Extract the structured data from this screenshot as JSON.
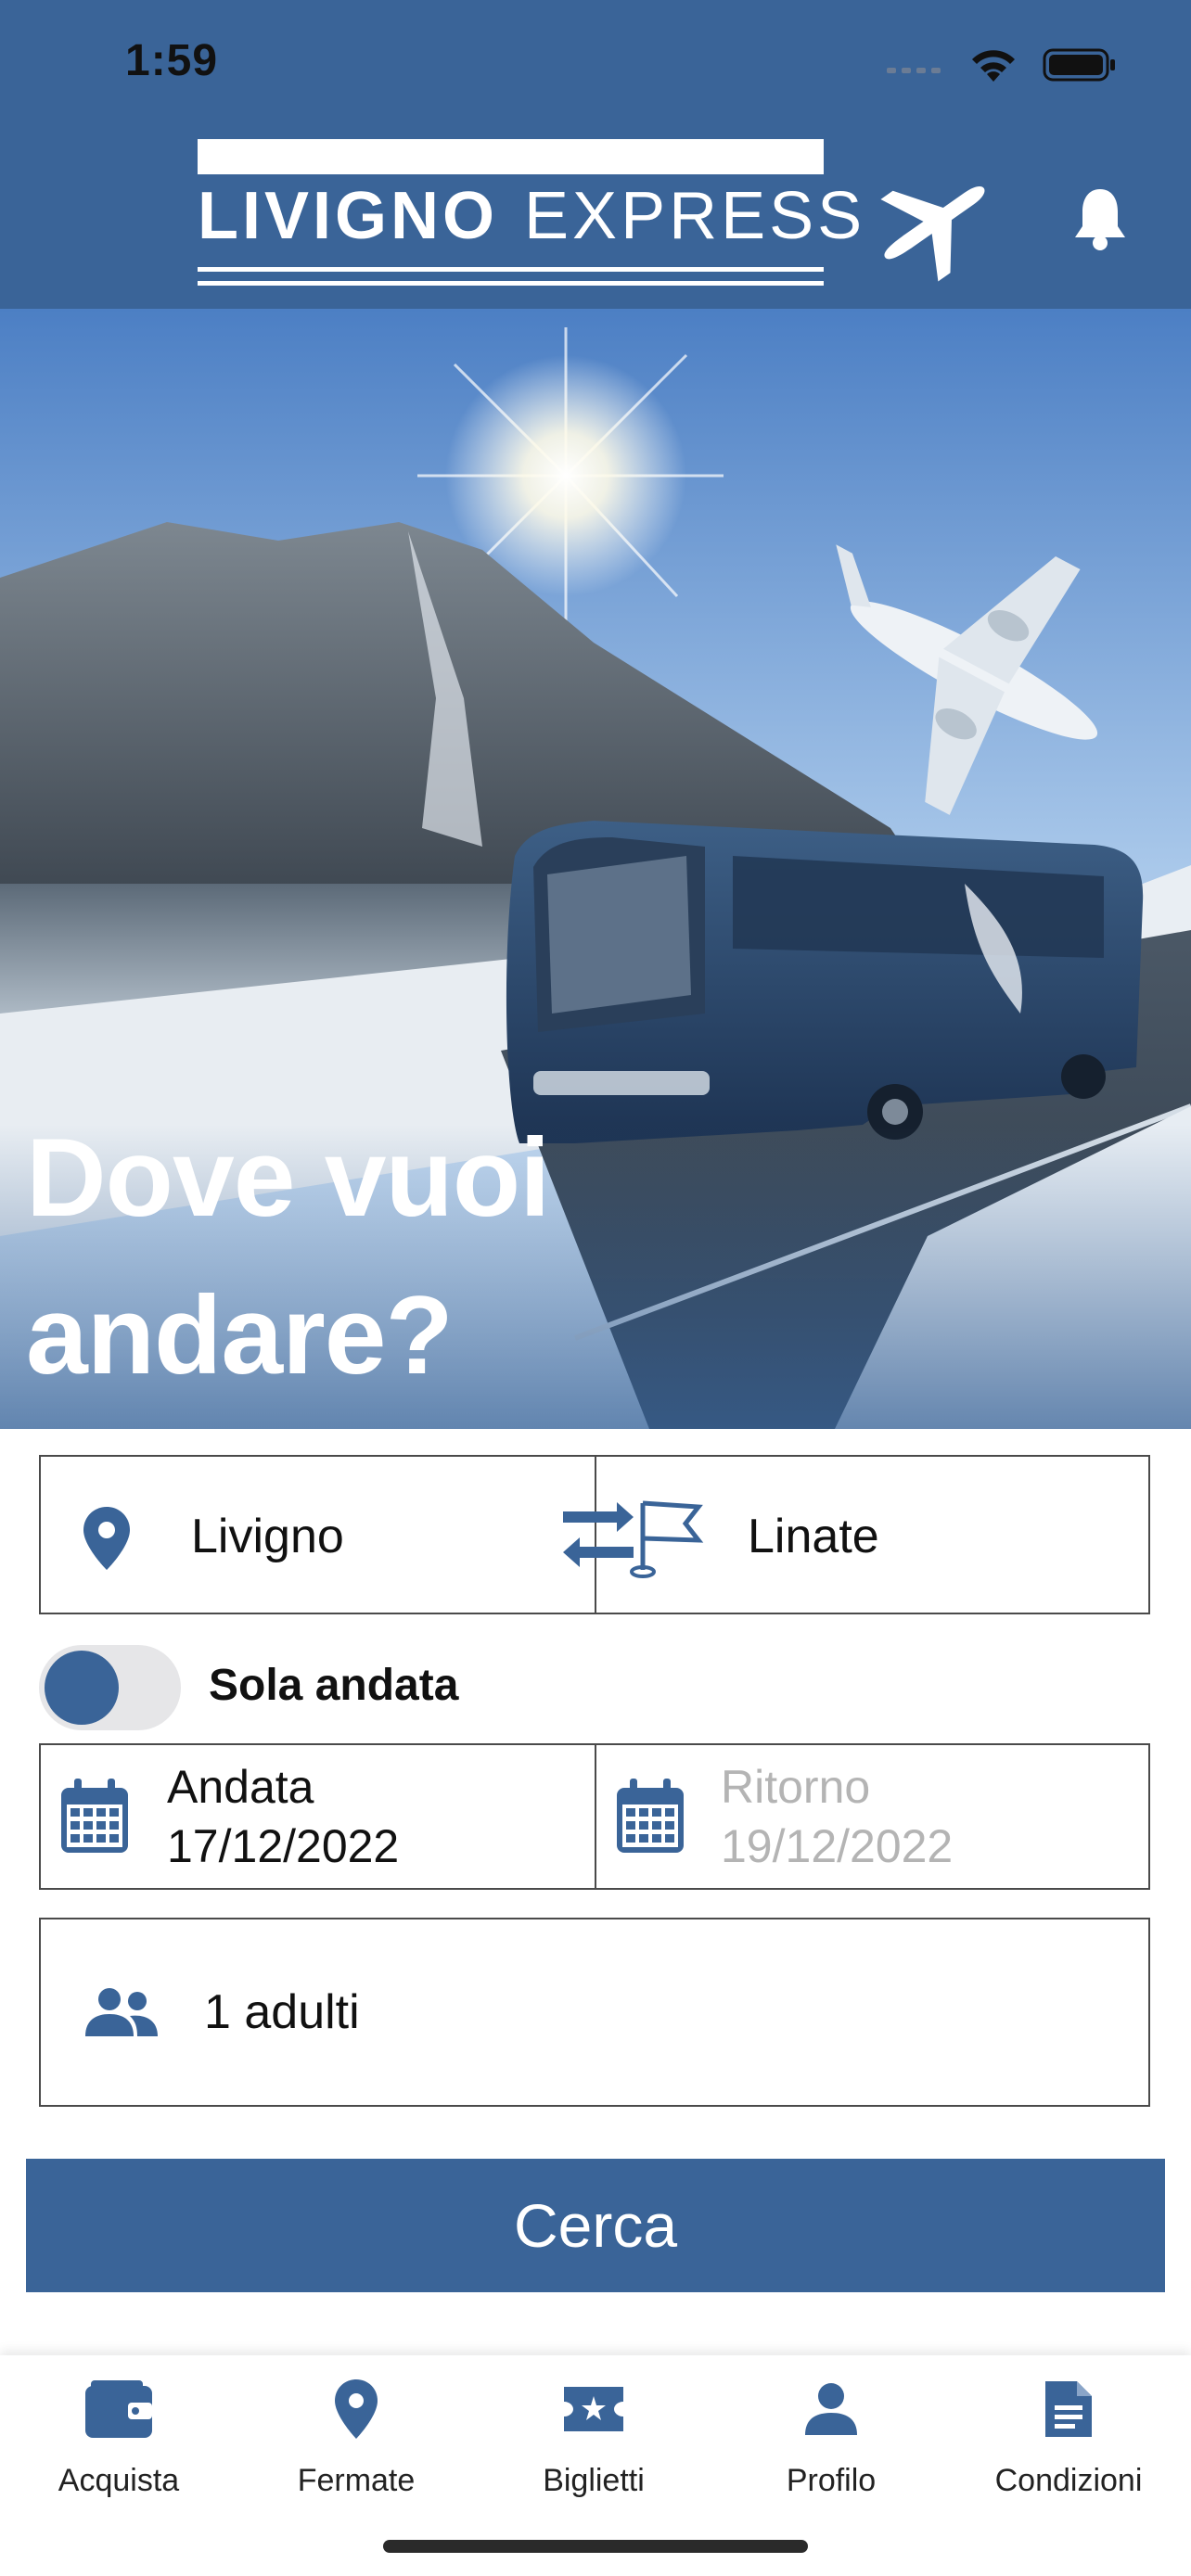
{
  "status_bar": {
    "time": "1:59"
  },
  "header": {
    "logo_bold": "LIVIGNO",
    "logo_light": "EXPRESS",
    "colors": {
      "primary": "#3a6498",
      "on_primary": "#ffffff"
    }
  },
  "hero": {
    "title_line1": "Dove vuoi",
    "title_line2": "andare?"
  },
  "route": {
    "origin": "Livigno",
    "destination": "Linate"
  },
  "one_way": {
    "label": "Sola andata",
    "enabled": true
  },
  "dates": {
    "departure_label": "Andata",
    "departure_value": "17/12/2022",
    "return_label": "Ritorno",
    "return_value": "19/12/2022"
  },
  "passengers": {
    "label": "1 adulti"
  },
  "search_button": {
    "label": "Cerca"
  },
  "tabbar": {
    "items": [
      {
        "label": "Acquista",
        "icon": "wallet-icon"
      },
      {
        "label": "Fermate",
        "icon": "map-pin-icon"
      },
      {
        "label": "Biglietti",
        "icon": "ticket-icon"
      },
      {
        "label": "Profilo",
        "icon": "person-icon"
      },
      {
        "label": "Condizioni",
        "icon": "document-icon"
      }
    ]
  }
}
